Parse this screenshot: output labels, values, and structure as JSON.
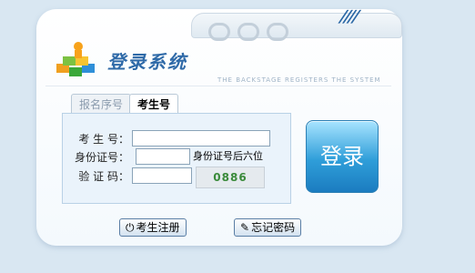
{
  "header": {
    "title": "登录系统",
    "subtitle": "THE BACKSTAGE REGISTERS THE SYSTEM",
    "stripes": "////"
  },
  "tabs": [
    {
      "label": "报名序号",
      "active": false
    },
    {
      "label": "考生号",
      "active": true
    }
  ],
  "form": {
    "examinee_label": "考 生 号：",
    "id_label": "身份证号：",
    "id_hint": "身份证号后六位",
    "captcha_label": "验 证 码：",
    "captcha_text": "0886"
  },
  "buttons": {
    "login_label": "登录",
    "register_label": "考生注册",
    "forgot_label": "忘记密码"
  },
  "icons": {
    "register": "power-icon",
    "forgot": "edit-icon"
  },
  "colors": {
    "accent": "#2f6aa8",
    "login_button": "#2f9ed9",
    "background": "#d9e7f2"
  }
}
